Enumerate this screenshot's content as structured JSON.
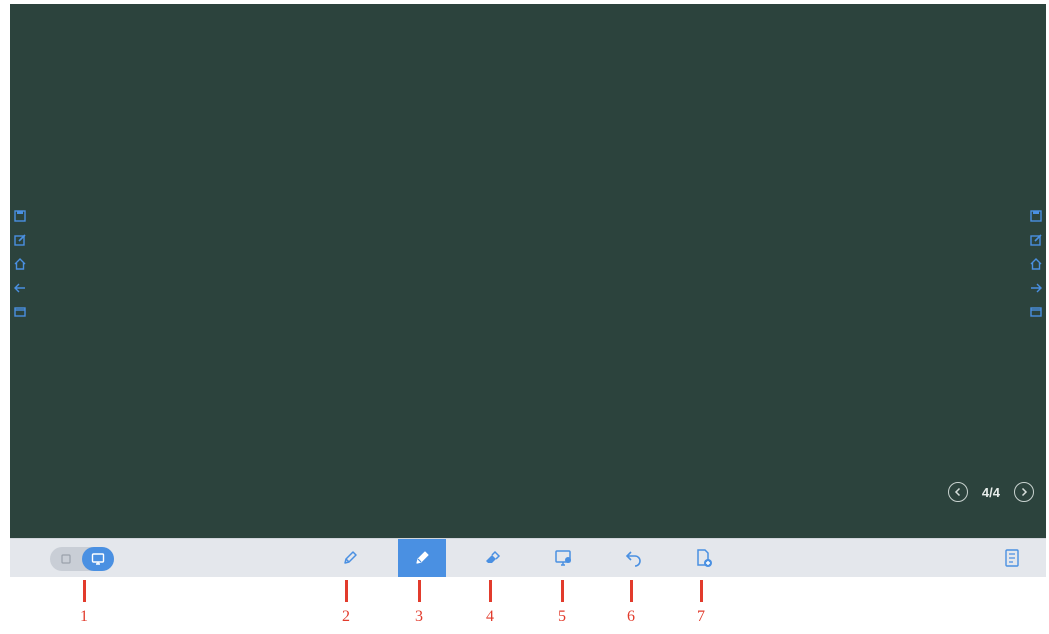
{
  "board": {
    "background": "#2c433d",
    "side_icons": [
      "save-icon",
      "edit-icon",
      "home-icon",
      "back-icon",
      "window-icon"
    ]
  },
  "pager": {
    "current": "4/4",
    "prev_icon": "chevron-left-icon",
    "next_icon": "chevron-right-icon"
  },
  "toolbar": {
    "accent": "#4a90e2",
    "mode_toggle": [
      "annotation-mode-icon",
      "whiteboard-mode-icon"
    ],
    "tools": [
      "pencil-icon",
      "pen-icon",
      "eraser-icon",
      "screen-capture-icon",
      "undo-icon",
      "add-page-icon"
    ],
    "active_tool": "pen-icon",
    "right_icon": "menu-panel-icon"
  },
  "callouts": [
    "1",
    "2",
    "3",
    "4",
    "5",
    "6",
    "7"
  ],
  "callout_color": "#e23b2c"
}
